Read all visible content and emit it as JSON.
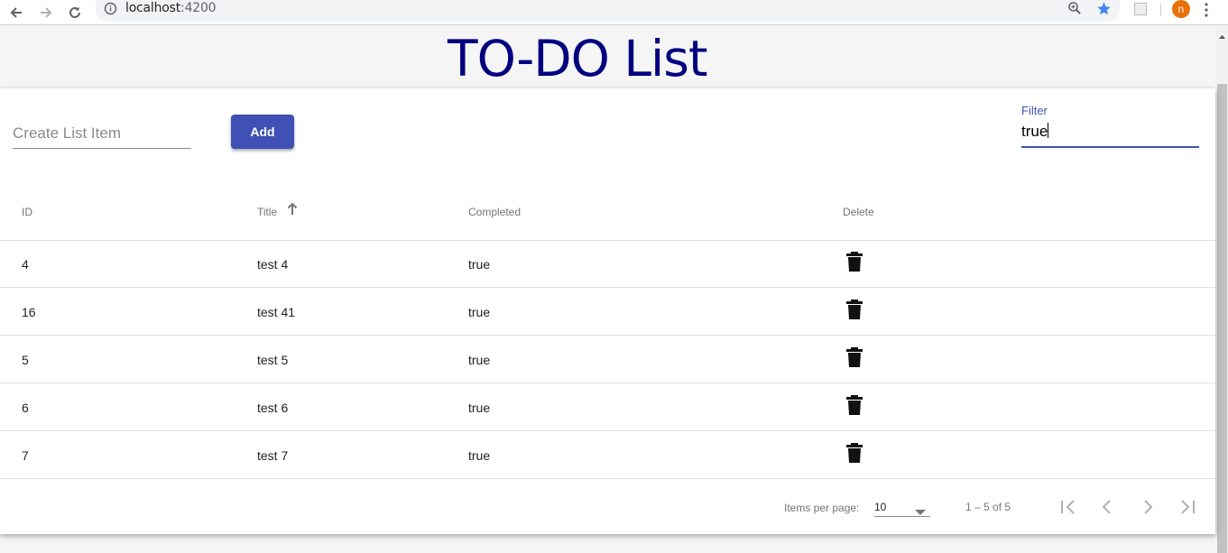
{
  "browser": {
    "url_host": "localhost",
    "url_port": ":4200",
    "avatar_letter": "n",
    "icons": [
      "back-arrow-icon",
      "forward-arrow-icon",
      "reload-icon",
      "info-icon",
      "zoom-icon",
      "star-icon",
      "extension-icon",
      "menu-dots-icon"
    ]
  },
  "app": {
    "title": "TO-DO List",
    "title_color": "#000080",
    "accent_color": "#3f51b5"
  },
  "toolbar": {
    "create_placeholder": "Create List Item",
    "add_label": "Add",
    "filter_label": "Filter",
    "filter_value": "true"
  },
  "table": {
    "columns": [
      "ID",
      "Title",
      "Completed",
      "Delete"
    ],
    "sort": {
      "column": "Title",
      "direction": "ascending"
    },
    "rows": [
      {
        "id": "4",
        "title": "test 4",
        "completed": "true"
      },
      {
        "id": "16",
        "title": "test 41",
        "completed": "true"
      },
      {
        "id": "5",
        "title": "test 5",
        "completed": "true"
      },
      {
        "id": "6",
        "title": "test 6",
        "completed": "true"
      },
      {
        "id": "7",
        "title": "test 7",
        "completed": "true"
      }
    ]
  },
  "paginator": {
    "items_per_page_label": "Items per page:",
    "page_size": "10",
    "range_label": "1 – 5 of 5"
  }
}
